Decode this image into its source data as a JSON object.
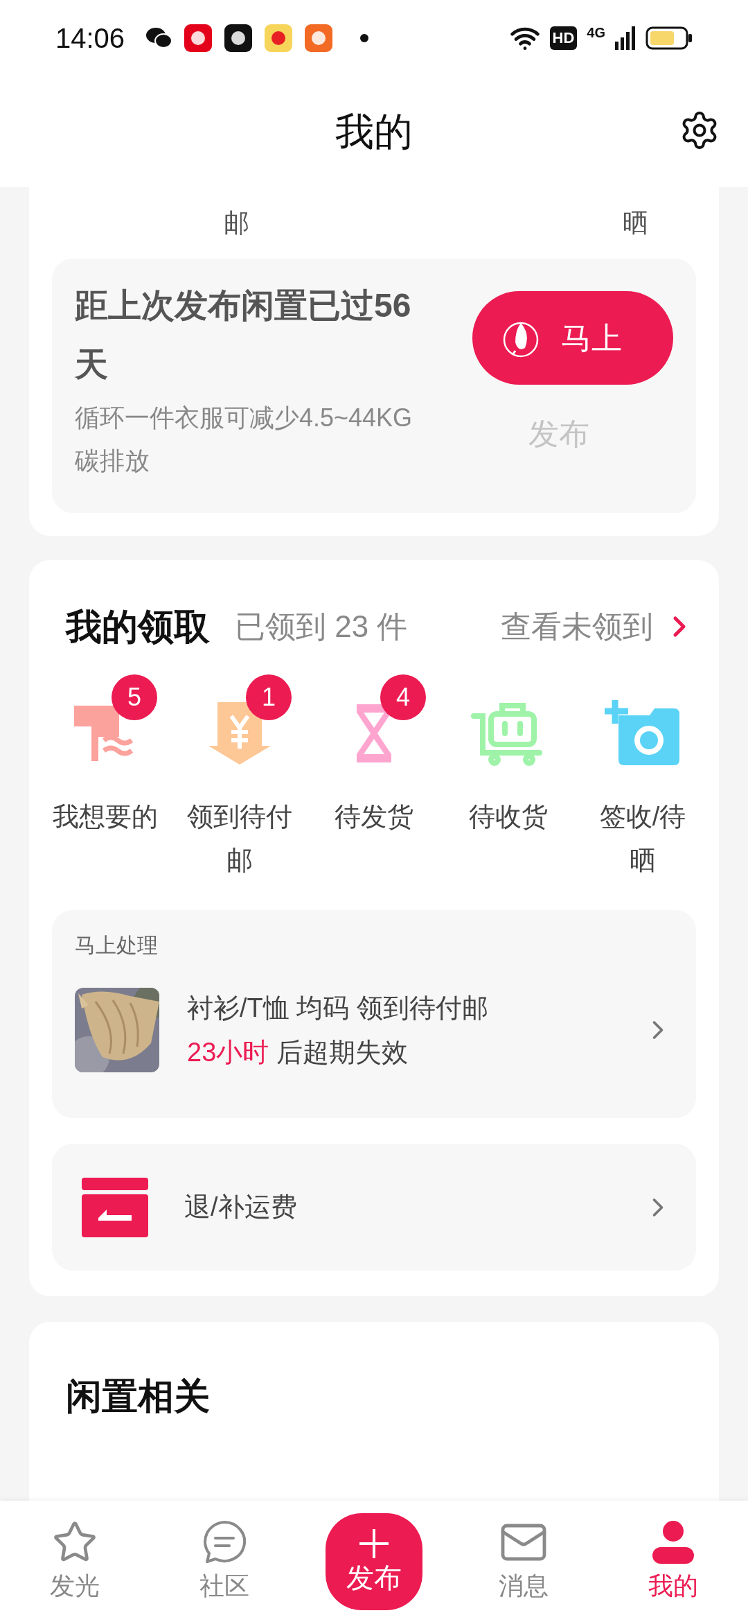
{
  "status_bar": {
    "time": "14:06",
    "network_badge": "HD",
    "network_type": "4G"
  },
  "header": {
    "title": "我的"
  },
  "order_row_fragments": [
    "邮",
    "晒"
  ],
  "publish_reminder": {
    "title": "距上次发布闲置已过56天",
    "subtitle": "循环一件衣服可减少4.5~44KG碳排放",
    "button": "马上",
    "button_overflow": "发布"
  },
  "my_claims": {
    "title": "我的领取",
    "count": "已领到 23 件",
    "link": "查看未领到",
    "statuses": [
      {
        "kind": "wanted",
        "label": "我想要的",
        "badge": "5"
      },
      {
        "kind": "unpaid",
        "label": "领到待付邮",
        "badge": "1"
      },
      {
        "kind": "to_ship",
        "label": "待发货",
        "badge": "4"
      },
      {
        "kind": "to_receive",
        "label": "待收货"
      },
      {
        "kind": "to_review",
        "label": "签收/待晒"
      }
    ]
  },
  "pending": {
    "heading": "马上处理",
    "item": {
      "kind": "picture",
      "title": "衬衫/T恤 均码 领到待付邮",
      "deadline": "23小时",
      "deadline_suffix": "后超期失效"
    }
  },
  "shipping_fee": {
    "label": "退/补运费"
  },
  "idle_section": {
    "title": "闲置相关"
  },
  "tab_bar": [
    {
      "kind": "star",
      "label": "发光",
      "selected": false
    },
    {
      "kind": "chat",
      "label": "社区",
      "selected": false
    },
    {
      "kind": "publish",
      "label": "发布",
      "selected": false
    },
    {
      "kind": "mail",
      "label": "消息",
      "selected": false
    },
    {
      "kind": "person",
      "label": "我的",
      "selected": true
    }
  ]
}
